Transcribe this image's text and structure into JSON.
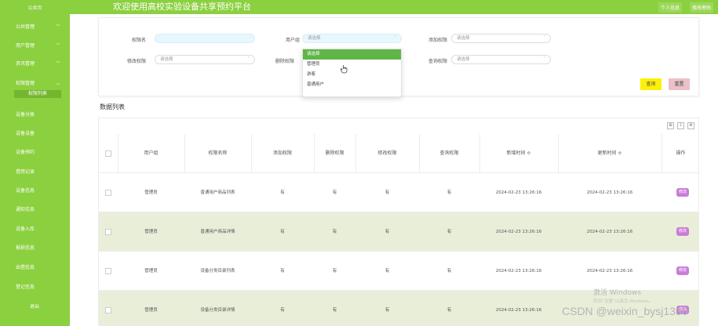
{
  "header": {
    "left_label": "公共页",
    "title": "欢迎使用高校实验设备共享预约平台",
    "buttons": [
      "个人信息",
      "修改密码"
    ]
  },
  "sidebar": {
    "items": [
      {
        "label": "公共管理",
        "chevron": "﹀"
      },
      {
        "label": "用户管理",
        "chevron": "﹀"
      },
      {
        "label": "资讯管理",
        "chevron": "﹀"
      },
      {
        "label": "权限管理",
        "chevron": "︿"
      },
      {
        "label": "设备分类",
        "chevron": ""
      },
      {
        "label": "设备设备",
        "chevron": ""
      },
      {
        "label": "设备预约",
        "chevron": ""
      },
      {
        "label": "借用记录",
        "chevron": ""
      },
      {
        "label": "设备信息",
        "chevron": ""
      },
      {
        "label": "通知信息",
        "chevron": ""
      },
      {
        "label": "设备入库",
        "chevron": ""
      },
      {
        "label": "报损信息",
        "chevron": ""
      },
      {
        "label": "出借信息",
        "chevron": ""
      },
      {
        "label": "登记信息",
        "chevron": ""
      },
      {
        "label": "退出",
        "chevron": ""
      }
    ],
    "active_sub": "权限列表"
  },
  "search": {
    "fields": [
      {
        "label": "权限名",
        "value": ""
      },
      {
        "label": "用户组",
        "value": "请选择"
      },
      {
        "label": "添加权限",
        "value": "请选择"
      },
      {
        "label": "修改权限",
        "value": "请选择"
      },
      {
        "label": "删除权限",
        "value": ""
      },
      {
        "label": "查询权限",
        "value": "请选择"
      }
    ],
    "dropdown_options": [
      "请选择",
      "管理员",
      "游客",
      "普通用户"
    ],
    "query_label": "查询",
    "reset_label": "重置"
  },
  "list_title": "数据列表",
  "tools": [
    "⊞",
    "⇩",
    "⚙"
  ],
  "table": {
    "headers": [
      "用户组",
      "权限名称",
      "添加权限",
      "删除权限",
      "修改权限",
      "查询权限",
      "新增时间 ≎",
      "更新时间 ≎",
      "操作"
    ],
    "rows": [
      [
        "管理员",
        "普通用户商品列表",
        "有",
        "有",
        "有",
        "有",
        "2024-02-23 13:26:16",
        "2024-02-23 13:26:16",
        "修改"
      ],
      [
        "管理员",
        "普通用户商品详情",
        "有",
        "有",
        "有",
        "有",
        "2024-02-23 13:26:16",
        "2024-02-23 13:26:16",
        "修改"
      ],
      [
        "管理员",
        "设备分类目录列表",
        "有",
        "有",
        "有",
        "有",
        "2024-02-23 13:26:16",
        "2024-02-23 13:26:16",
        "修改"
      ],
      [
        "管理员",
        "设备分类目录详情",
        "有",
        "有",
        "有",
        "有",
        "2024-02-23 13:26:16",
        "",
        "修改"
      ]
    ]
  },
  "watermark": {
    "line1": "激活 Windows",
    "line2": "转到“设置”以激活 Windows。"
  },
  "csdn": "CSDN @weixin_bysj1330",
  "colors": {
    "brand_green": "#8bd03f",
    "query_yellow": "#fdf00a",
    "reset_pink": "#ebc1c8",
    "edit_purple": "#c97dd8",
    "alt_row": "#e9eed9"
  }
}
